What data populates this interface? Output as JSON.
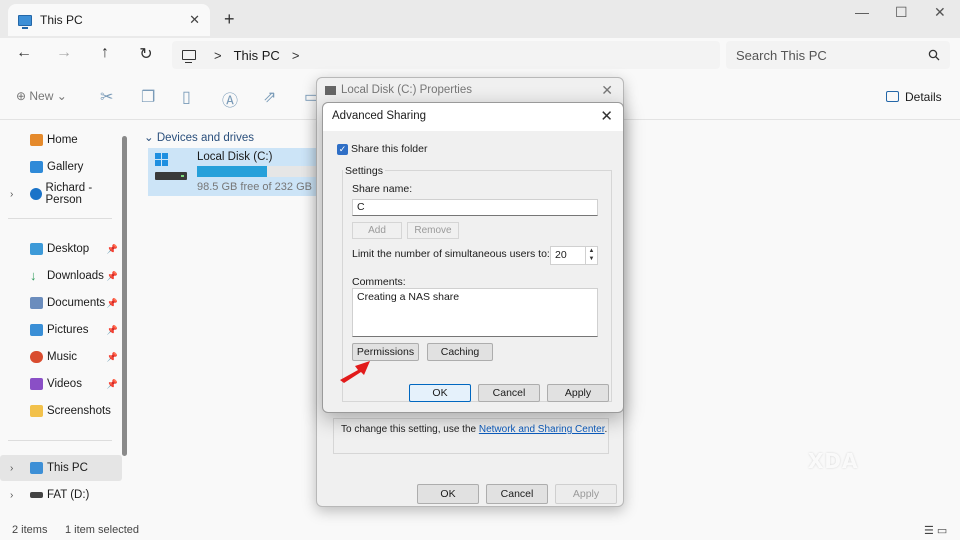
{
  "tab": {
    "title": "This PC",
    "close": "✕"
  },
  "window_controls": [
    "—",
    "☐",
    "✕"
  ],
  "nav": {
    "back": "←",
    "forward": "→",
    "up": "↑",
    "refresh": "↻"
  },
  "address": {
    "crumbs": [
      "This PC"
    ],
    "sep": ">"
  },
  "search": {
    "placeholder": "Search This PC",
    "icon": "search-icon"
  },
  "toolbar": {
    "new_label": "New",
    "details_label": "Details"
  },
  "sidebar": {
    "items": [
      {
        "label": "Home",
        "icon": "home-icon",
        "color": "#e58a2c"
      },
      {
        "label": "Gallery",
        "icon": "gallery-icon",
        "color": "#2f8ad8"
      },
      {
        "label": "Richard - Person",
        "icon": "onedrive-icon",
        "color": "#1a73c8"
      },
      {
        "label": "Desktop",
        "icon": "desktop-icon",
        "color": "#3d9ad8"
      },
      {
        "label": "Downloads",
        "icon": "download-icon",
        "color": "#2f9b5b"
      },
      {
        "label": "Documents",
        "icon": "documents-icon",
        "color": "#6b8dbd"
      },
      {
        "label": "Pictures",
        "icon": "pictures-icon",
        "color": "#3a8fd6"
      },
      {
        "label": "Music",
        "icon": "music-icon",
        "color": "#d94c2f"
      },
      {
        "label": "Videos",
        "icon": "videos-icon",
        "color": "#8a4fc6"
      },
      {
        "label": "Screenshots",
        "icon": "folder-icon",
        "color": "#f2c14b"
      },
      {
        "label": "This PC",
        "icon": "pc-icon",
        "color": "#3d8fd6"
      },
      {
        "label": "FAT (D:)",
        "icon": "drive-icon",
        "color": "#444444"
      }
    ]
  },
  "main": {
    "section_label": "Devices and drives",
    "drive": {
      "name": "Local Disk (C:)",
      "free": "98.5 GB free of 232 GB",
      "used_fraction": 0.58
    }
  },
  "status": {
    "count": "2 items",
    "selected": "1 item selected"
  },
  "properties": {
    "title": "Local Disk (C:) Properties",
    "help_prefix": "To change this setting, use the",
    "help_link": "Network and Sharing Center",
    "help_suffix": ".",
    "ok": "OK",
    "cancel": "Cancel",
    "apply": "Apply"
  },
  "advanced": {
    "title": "Advanced Sharing",
    "share_checkbox": "Share this folder",
    "settings_label": "Settings",
    "share_name_label": "Share name:",
    "share_name_value": "C",
    "add": "Add",
    "remove": "Remove",
    "limit_label": "Limit the number of simultaneous users to:",
    "limit_value": "20",
    "comments_label": "Comments:",
    "comments_value": "Creating a NAS share",
    "permissions": "Permissions",
    "caching": "Caching",
    "ok": "OK",
    "cancel": "Cancel",
    "apply": "Apply"
  },
  "watermark": "XDA",
  "accent": "#0067c0",
  "arrow_color": "#e21b1b"
}
